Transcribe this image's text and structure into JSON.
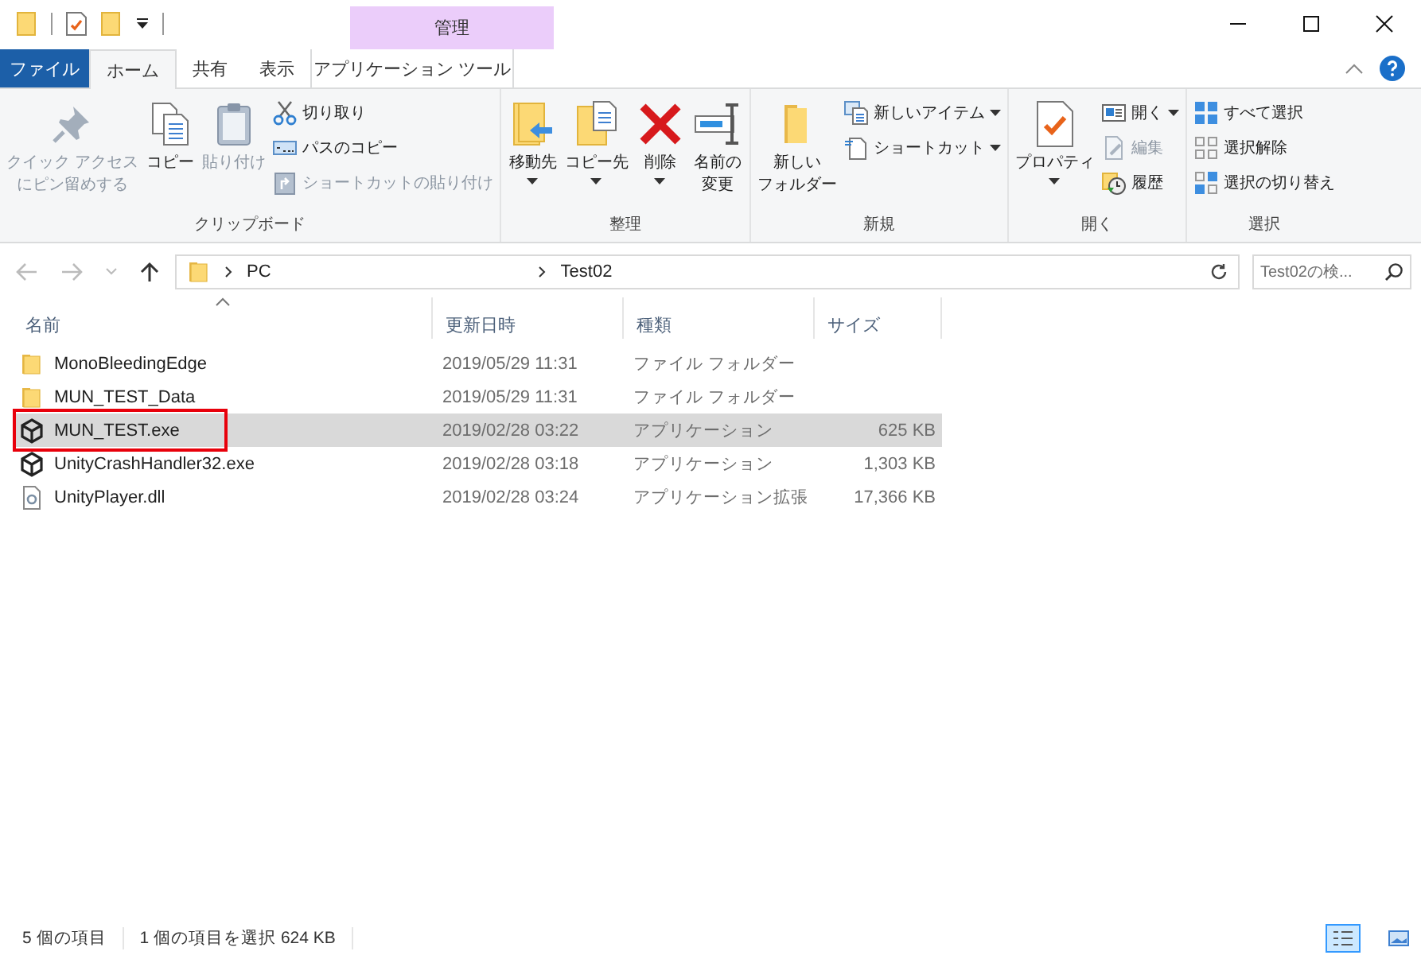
{
  "title_bar": {
    "context_group": "管理"
  },
  "tabs": [
    {
      "label": "ファイル",
      "kind": "file",
      "selected": false
    },
    {
      "label": "ホーム",
      "kind": "normal",
      "selected": true
    },
    {
      "label": "共有",
      "kind": "normal",
      "selected": false
    },
    {
      "label": "表示",
      "kind": "normal",
      "selected": false
    },
    {
      "label": "アプリケーション ツール",
      "kind": "context",
      "selected": false
    }
  ],
  "ribbon": {
    "groups": [
      {
        "label": "クリップボード",
        "large": [
          {
            "lines": [
              "クイック アクセス",
              "にピン留めする"
            ],
            "disabled": true,
            "menu": false
          },
          {
            "lines": [
              "コピー"
            ],
            "disabled": false,
            "menu": false
          },
          {
            "lines": [
              "貼り付け"
            ],
            "disabled": true,
            "menu": false
          }
        ],
        "small": [
          {
            "label": "切り取り",
            "disabled": false,
            "menu": false
          },
          {
            "label": "パスのコピー",
            "disabled": false,
            "menu": false
          },
          {
            "label": "ショートカットの貼り付け",
            "disabled": true,
            "menu": false
          }
        ]
      },
      {
        "label": "整理",
        "large": [
          {
            "lines": [
              "移動先"
            ],
            "disabled": false,
            "menu": true
          },
          {
            "lines": [
              "コピー先"
            ],
            "disabled": false,
            "menu": true
          },
          {
            "lines": [
              "削除"
            ],
            "disabled": false,
            "menu": true
          },
          {
            "lines": [
              "名前の",
              "変更"
            ],
            "disabled": false,
            "menu": false
          }
        ]
      },
      {
        "label": "新規",
        "large": [
          {
            "lines": [
              "新しい",
              "フォルダー"
            ],
            "disabled": false,
            "menu": false
          }
        ],
        "small": [
          {
            "label": "新しいアイテム",
            "disabled": false,
            "menu": true
          },
          {
            "label": "ショートカット",
            "disabled": false,
            "menu": true
          }
        ]
      },
      {
        "label": "開く",
        "large": [
          {
            "lines": [
              "プロパティ"
            ],
            "disabled": false,
            "menu": true
          }
        ],
        "small": [
          {
            "label": "開く",
            "disabled": false,
            "menu": true
          },
          {
            "label": "編集",
            "disabled": true,
            "menu": false
          },
          {
            "label": "履歴",
            "disabled": false,
            "menu": false
          }
        ]
      },
      {
        "label": "選択",
        "small": [
          {
            "label": "すべて選択",
            "disabled": false
          },
          {
            "label": "選択解除",
            "disabled": false
          },
          {
            "label": "選択の切り替え",
            "disabled": false
          }
        ]
      }
    ]
  },
  "address": {
    "path": [
      "PC",
      "Test02"
    ],
    "search_placeholder": "Test02の検..."
  },
  "columns": [
    {
      "label": "名前",
      "sorted": true
    },
    {
      "label": "更新日時",
      "sorted": false
    },
    {
      "label": "種類",
      "sorted": false
    },
    {
      "label": "サイズ",
      "sorted": false
    }
  ],
  "rows": [
    {
      "name": "MonoBleedingEdge",
      "date": "2019/05/29 11:31",
      "type": "ファイル フォルダー",
      "size": "",
      "kind": "folder",
      "selected": false,
      "highlighted": false
    },
    {
      "name": "MUN_TEST_Data",
      "date": "2019/05/29 11:31",
      "type": "ファイル フォルダー",
      "size": "",
      "kind": "folder",
      "selected": false,
      "highlighted": false
    },
    {
      "name": "MUN_TEST.exe",
      "date": "2019/02/28 03:22",
      "type": "アプリケーション",
      "size": "625 KB",
      "kind": "app",
      "selected": true,
      "highlighted": true
    },
    {
      "name": "UnityCrashHandler32.exe",
      "date": "2019/02/28 03:18",
      "type": "アプリケーション",
      "size": "1,303 KB",
      "kind": "app",
      "selected": false,
      "highlighted": false
    },
    {
      "name": "UnityPlayer.dll",
      "date": "2019/02/28 03:24",
      "type": "アプリケーション拡張",
      "size": "17,366 KB",
      "kind": "dll",
      "selected": false,
      "highlighted": false
    }
  ],
  "status_bar": {
    "count": "5 個の項目",
    "selection": "1 個の項目を選択  624 KB",
    "views": [
      {
        "kind": "details",
        "selected": true
      },
      {
        "kind": "thumbnails",
        "selected": false
      }
    ]
  }
}
